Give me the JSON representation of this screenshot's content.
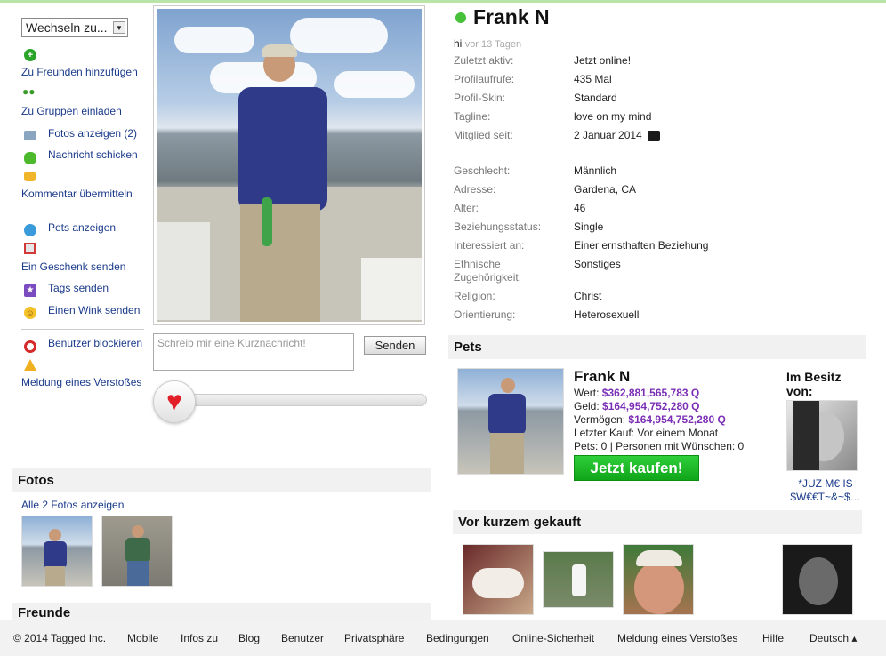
{
  "switcher": {
    "label": "Wechseln zu..."
  },
  "actions": {
    "add_friend": "Zu Freunden hinzufügen",
    "invite_groups": "Zu Gruppen einladen",
    "show_photos": "Fotos anzeigen (2)",
    "send_message": "Nachricht schicken",
    "send_comment": "Kommentar übermitteln",
    "show_pets": "Pets anzeigen",
    "send_gift": "Ein Geschenk senden",
    "send_tags": "Tags senden",
    "send_wink": "Einen Wink senden",
    "block_user": "Benutzer blockieren",
    "report": "Meldung eines Verstoßes"
  },
  "shortmsg": {
    "placeholder": "Schreib mir eine Kurznachricht!",
    "send_label": "Senden"
  },
  "photos": {
    "title": "Fotos",
    "show_all": "Alle 2 Fotos anzeigen"
  },
  "friends": {
    "title": "Freunde"
  },
  "profile": {
    "name": "Frank N",
    "status_color": "#47c03a",
    "hi": "hi",
    "hi_time": "vor 13 Tagen",
    "fields": [
      {
        "label": "Zuletzt aktiv:",
        "value": "Jetzt online!"
      },
      {
        "label": "Profilaufrufe:",
        "value": "435 Mal"
      },
      {
        "label": "Profil-Skin:",
        "value": "Standard"
      },
      {
        "label": "Tagline:",
        "value": "love on my mind"
      },
      {
        "label": "Mitglied seit:",
        "value": "2 Januar 2014"
      },
      {
        "label": "Geschlecht:",
        "value": "Männlich"
      },
      {
        "label": "Adresse:",
        "value": "Gardena, CA"
      },
      {
        "label": "Alter:",
        "value": "46"
      },
      {
        "label": "Beziehungsstatus:",
        "value": "Single"
      },
      {
        "label": "Interessiert an:",
        "value": "Einer ernsthaften Beziehung"
      },
      {
        "label": "Ethnische Zugehörigkeit:",
        "value": "Sonstiges"
      },
      {
        "label": "Religion:",
        "value": "Christ"
      },
      {
        "label": "Orientierung:",
        "value": "Heterosexuell"
      }
    ]
  },
  "pets": {
    "title": "Pets",
    "name": "Frank N",
    "worth_label": "Wert:",
    "worth": "$362,881,565,783",
    "cash_label": "Geld:",
    "cash": "$164,954,752,280",
    "assets_label": "Vermögen:",
    "assets": "$164,954,752,280",
    "currency_suffix": "Q",
    "last_buy": "Letzter Kauf: Vor einem Monat",
    "pets_line": "Pets: 0 | Personen mit Wünschen: 0",
    "buy_label": "Jetzt kaufen!",
    "owned_by": "Im Besitz von:",
    "owner_name": "*JUZ M€ IS $W€€T~&~$…"
  },
  "recent": {
    "title": "Vor kurzem gekauft"
  },
  "footer": {
    "copyright": "© 2014 Tagged Inc.",
    "links": [
      "Mobile",
      "Infos zu",
      "Blog",
      "Benutzer",
      "Privatsphäre",
      "Bedingungen",
      "Online-Sicherheit",
      "Meldung eines Verstoßes",
      "Hilfe",
      "Deutsch ▴"
    ]
  }
}
